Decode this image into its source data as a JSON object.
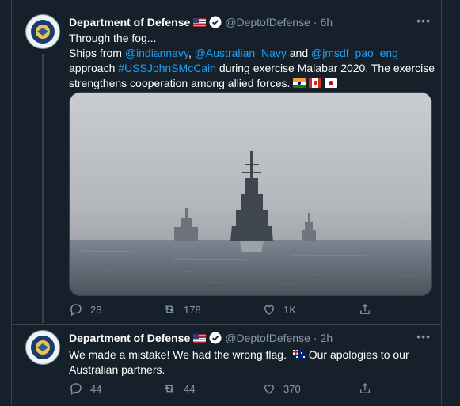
{
  "tweets": [
    {
      "name": "Department of Defense",
      "handle": "@DeptofDefense",
      "dot": "·",
      "time": "6h",
      "more": "•••",
      "text_line1": "Through the fog...",
      "text_segments": [
        {
          "t": "Ships from ",
          "link": false
        },
        {
          "t": "@indiannavy",
          "link": true
        },
        {
          "t": ", ",
          "link": false
        },
        {
          "t": "@Australian_Navy",
          "link": true
        },
        {
          "t": " and ",
          "link": false
        },
        {
          "t": "@jmsdf_pao_eng",
          "link": true
        },
        {
          "t": " approach ",
          "link": false
        },
        {
          "t": "#USSJohnSMcCain",
          "link": true
        },
        {
          "t": " during exercise Malabar 2020. The exercise strengthens cooperation among allied forces.",
          "link": false
        }
      ],
      "flags": [
        "india-flag",
        "canada-flag",
        "japan-flag"
      ],
      "stats": {
        "replies": "28",
        "retweets": "178",
        "likes": "1K"
      }
    },
    {
      "name": "Department of Defense",
      "handle": "@DeptofDefense",
      "dot": "·",
      "time": "2h",
      "more": "•••",
      "text_part1": "We made a mistake! We had the wrong flag.",
      "text_part2": "Our apologies to our Australian partners.",
      "flag": "australia-flag",
      "stats": {
        "replies": "44",
        "retweets": "44",
        "likes": "370"
      }
    }
  ],
  "colors": {
    "background": "#15202b",
    "link": "#1da1f2",
    "secondary_text": "#8899a6",
    "border": "#38444d"
  },
  "icons": [
    "reply-icon",
    "retweet-icon",
    "like-icon",
    "share-icon",
    "verified-icon",
    "more-icon"
  ]
}
